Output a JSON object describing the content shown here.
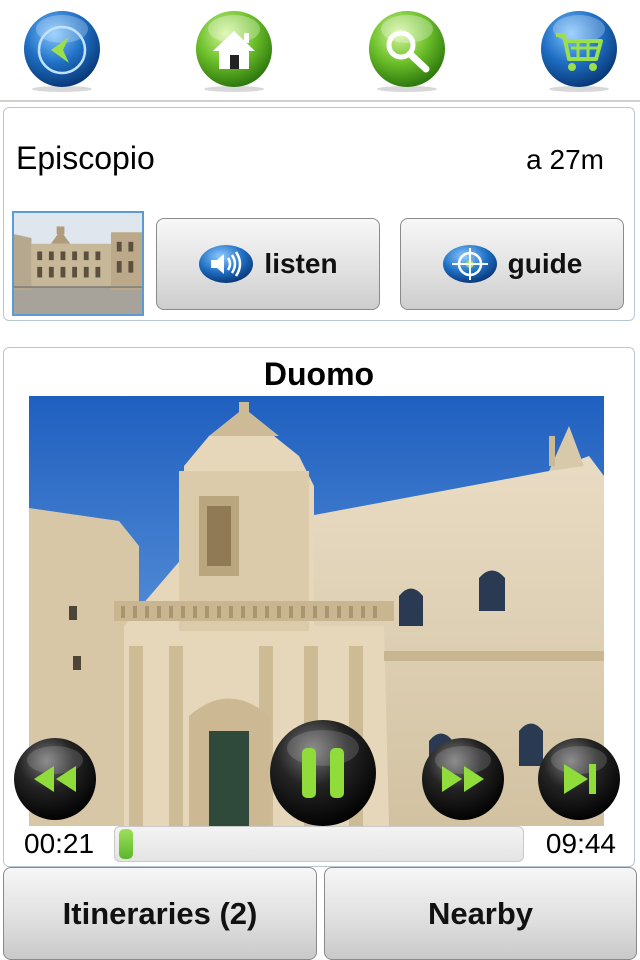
{
  "nav": {
    "back_icon": "back-arrow-icon",
    "home_icon": "home-icon",
    "search_icon": "search-icon",
    "cart_icon": "cart-icon"
  },
  "place": {
    "title": "Episcopio",
    "distance": "a 27m"
  },
  "actions": {
    "listen_label": "listen",
    "guide_label": "guide"
  },
  "player": {
    "title": "Duomo",
    "elapsed": "00:21",
    "duration": "09:44",
    "progress": 0.036
  },
  "bottom": {
    "itineraries_label": "Itineraries (2)",
    "nearby_label": "Nearby"
  },
  "colors": {
    "blue_orb": "#1f6fc4",
    "green_orb": "#6cbf2a",
    "accent_border": "#b9c7d4",
    "progress_green": "#5bb82a"
  }
}
